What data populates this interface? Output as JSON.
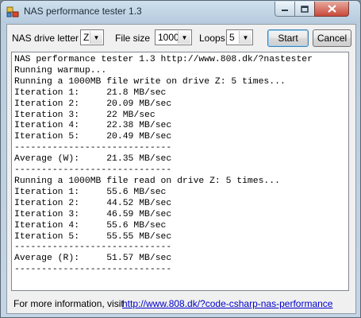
{
  "window": {
    "title": "NAS performance tester 1.3"
  },
  "toolbar": {
    "drive_label": "NAS drive letter",
    "drive_value": "Z",
    "filesize_label": "File size",
    "filesize_value": "1000",
    "loops_label": "Loops",
    "loops_value": "5",
    "start_label": "Start",
    "cancel_label": "Cancel"
  },
  "console": {
    "lines": [
      "NAS performance tester 1.3 http://www.808.dk/?nastester",
      "Running warmup...",
      "Running a 1000MB file write on drive Z: 5 times...",
      "Iteration 1:     21.8 MB/sec",
      "Iteration 2:     20.09 MB/sec",
      "Iteration 3:     22 MB/sec",
      "Iteration 4:     22.38 MB/sec",
      "Iteration 5:     20.49 MB/sec",
      "-----------------------------",
      "Average (W):     21.35 MB/sec",
      "-----------------------------",
      "Running a 1000MB file read on drive Z: 5 times...",
      "Iteration 1:     55.6 MB/sec",
      "Iteration 2:     44.52 MB/sec",
      "Iteration 3:     46.59 MB/sec",
      "Iteration 4:     55.6 MB/sec",
      "Iteration 5:     55.55 MB/sec",
      "-----------------------------",
      "Average (R):     51.57 MB/sec",
      "-----------------------------"
    ]
  },
  "footer": {
    "text": "For more information, visit",
    "link": "http://www.808.dk/?code-csharp-nas-performance"
  }
}
